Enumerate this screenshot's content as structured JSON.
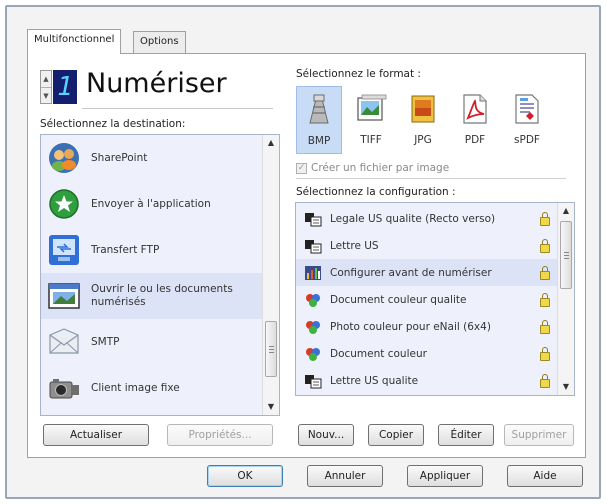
{
  "tabs": [
    {
      "label": "Multifonctionnel",
      "active": true
    },
    {
      "label": "Options",
      "active": false
    }
  ],
  "header": {
    "counter": "1",
    "title": "Numériser"
  },
  "destination": {
    "label": "Sélectionnez la destination:",
    "items": [
      {
        "label": "SharePoint",
        "icon": "sharepoint-icon",
        "selected": false
      },
      {
        "label": "Envoyer à l'application",
        "icon": "send-to-app-icon",
        "selected": false
      },
      {
        "label": "Transfert FTP",
        "icon": "ftp-transfer-icon",
        "selected": false
      },
      {
        "label": "Ouvrir le ou les documents numérisés",
        "icon": "open-document-icon",
        "selected": true
      },
      {
        "label": "SMTP",
        "icon": "smtp-mail-icon",
        "selected": false
      },
      {
        "label": "Client image fixe",
        "icon": "still-image-camera-icon",
        "selected": false
      }
    ]
  },
  "format": {
    "label": "Sélectionnez le format :",
    "options": [
      {
        "label": "BMP",
        "selected": true
      },
      {
        "label": "TIFF",
        "selected": false
      },
      {
        "label": "JPG",
        "selected": false
      },
      {
        "label": "PDF",
        "selected": false
      },
      {
        "label": "sPDF",
        "selected": false
      }
    ],
    "checkbox_label": "Créer un fichier par image",
    "checkbox_checked": true
  },
  "configuration": {
    "label": "Sélectionnez la configuration :",
    "items": [
      {
        "label": "Legale US qualite (Recto verso)",
        "icon": "scanner-icon",
        "selected": false
      },
      {
        "label": "Lettre US",
        "icon": "scanner-icon",
        "selected": false
      },
      {
        "label": "Configurer avant de numériser",
        "icon": "configure-icon",
        "selected": true
      },
      {
        "label": "Document couleur qualite",
        "icon": "color-doc-icon",
        "selected": false
      },
      {
        "label": "Photo couleur pour eNail (6x4)",
        "icon": "color-doc-icon",
        "selected": false
      },
      {
        "label": "Document couleur",
        "icon": "color-doc-icon",
        "selected": false
      },
      {
        "label": "Lettre US qualite",
        "icon": "scanner-icon",
        "selected": false
      }
    ]
  },
  "buttons": {
    "refresh": "Actualiser",
    "properties": "Propriétés...",
    "new": "Nouv...",
    "copy": "Copier",
    "edit": "Éditer",
    "delete": "Supprimer",
    "ok": "OK",
    "cancel": "Annuler",
    "apply": "Appliquer",
    "help": "Aide"
  }
}
